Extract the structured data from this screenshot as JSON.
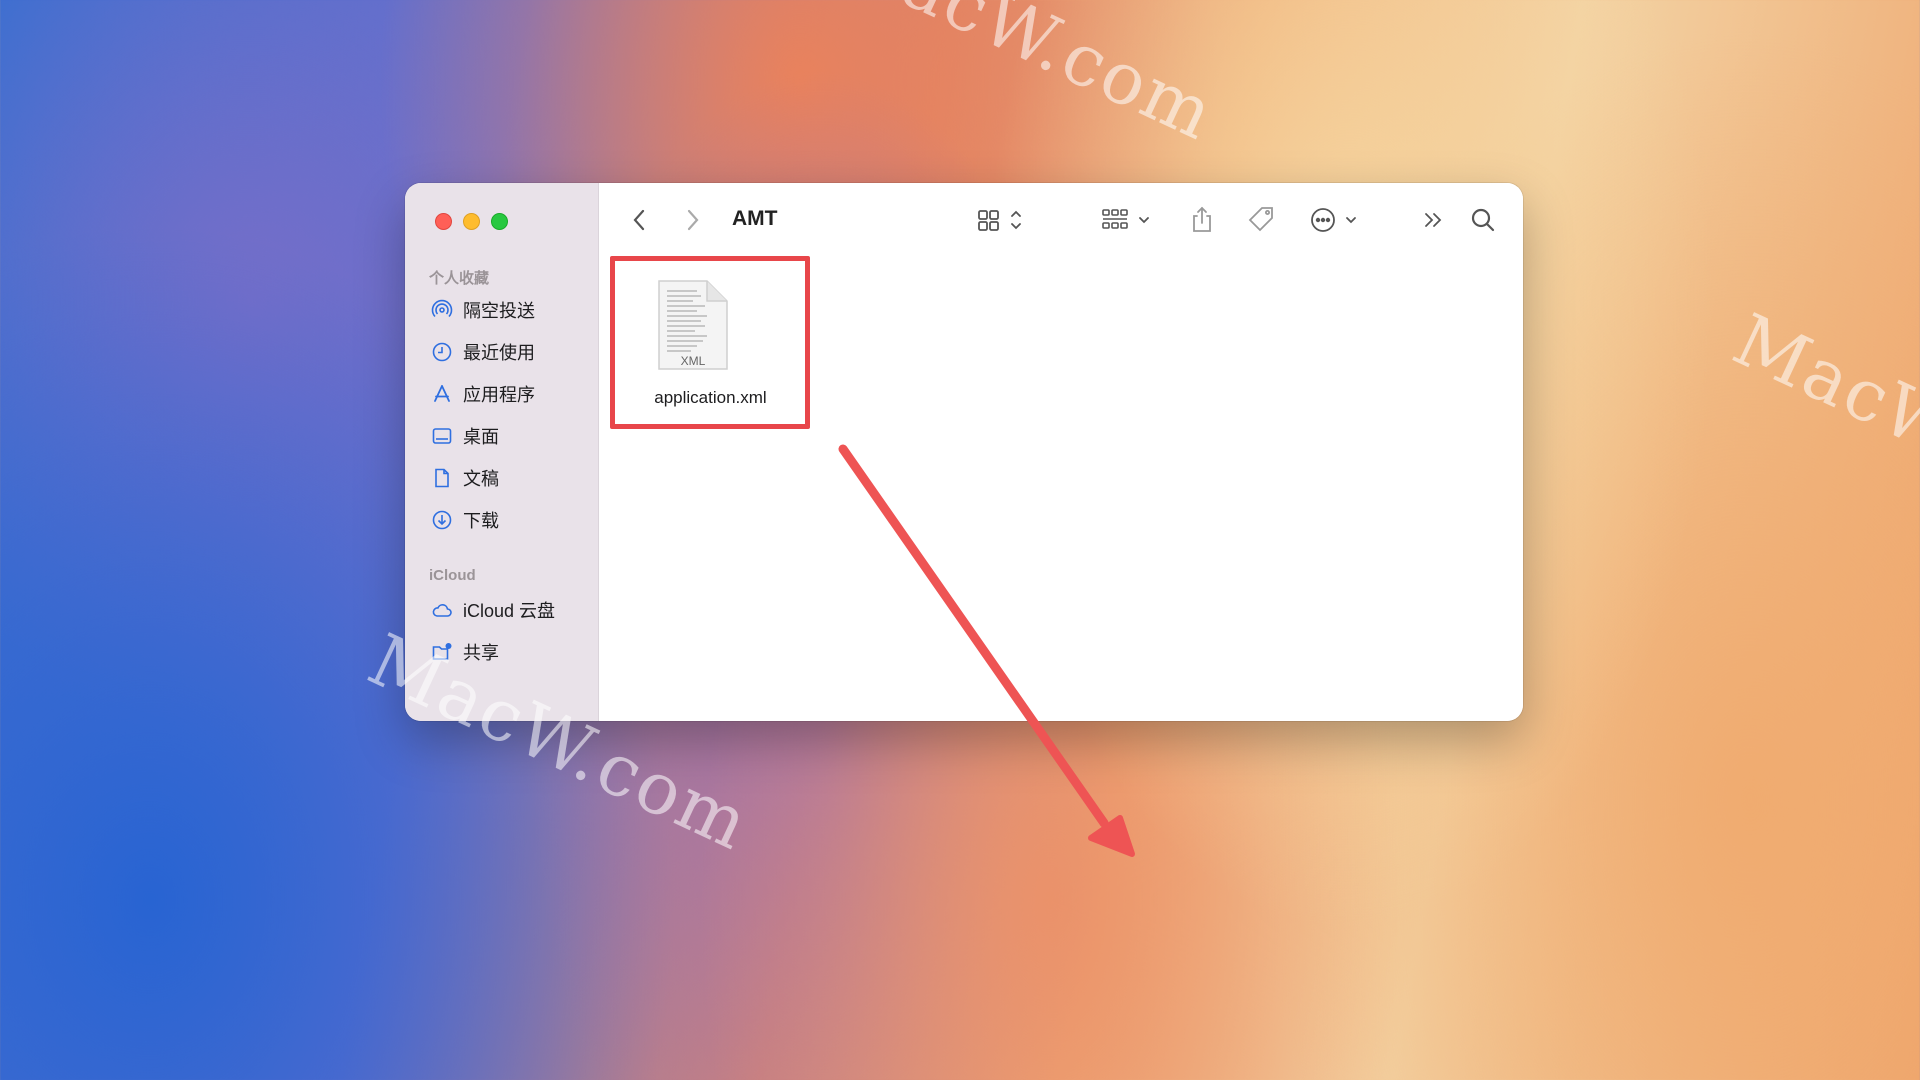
{
  "watermark": {
    "text": "MacW.com"
  },
  "window": {
    "title": "AMT",
    "traffic_lights": {
      "close": "#ff5f57",
      "minimize": "#febc2e",
      "zoom": "#28c840"
    }
  },
  "sidebar": {
    "favorites_title": "个人收藏",
    "favorites": [
      {
        "label": "隔空投送",
        "icon": "airdrop-icon"
      },
      {
        "label": "最近使用",
        "icon": "clock-icon"
      },
      {
        "label": "应用程序",
        "icon": "applications-icon"
      },
      {
        "label": "桌面",
        "icon": "desktop-icon"
      },
      {
        "label": "文稿",
        "icon": "document-icon"
      },
      {
        "label": "下载",
        "icon": "download-icon"
      }
    ],
    "icloud_title": "iCloud",
    "icloud": [
      {
        "label": "iCloud 云盘",
        "icon": "cloud-icon"
      },
      {
        "label": "共享",
        "icon": "shared-folder-icon"
      }
    ]
  },
  "toolbar": {
    "icons": [
      "back-icon",
      "forward-icon",
      "icon-view-icon",
      "group-icon",
      "share-icon",
      "tag-icon",
      "more-icon",
      "overflow-icon",
      "search-icon"
    ]
  },
  "files": [
    {
      "name": "application.xml",
      "type_label": "XML",
      "selected": true
    }
  ],
  "colors": {
    "highlight": "#e8464a",
    "accent": "#2f6fe0"
  }
}
